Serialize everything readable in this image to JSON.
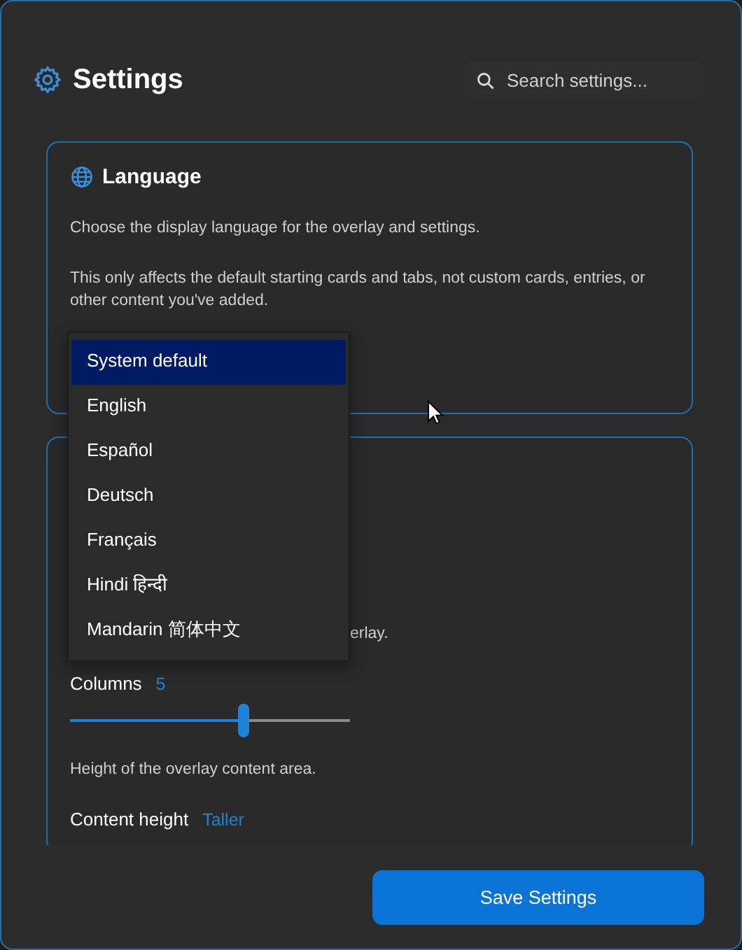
{
  "header": {
    "title": "Settings",
    "search": {
      "placeholder": "Search settings..."
    }
  },
  "language_card": {
    "title": "Language",
    "description": "Choose the display language for the overlay and settings.",
    "note": "This only affects the default starting cards and tabs, not custom cards, entries, or other content you've added."
  },
  "language_dropdown": {
    "options": [
      {
        "label": "System default",
        "selected": true
      },
      {
        "label": "English",
        "selected": false
      },
      {
        "label": "Español",
        "selected": false
      },
      {
        "label": "Deutsch",
        "selected": false
      },
      {
        "label": "Français",
        "selected": false
      },
      {
        "label": "Hindi हिन्दी",
        "selected": false
      },
      {
        "label": "Mandarin 简体中文",
        "selected": false
      }
    ]
  },
  "layout_card": {
    "description_fragment": "erlay.",
    "columns": {
      "label": "Columns",
      "value": "5",
      "level": 0.62
    },
    "height_description": "Height of the overlay content area.",
    "content_height": {
      "label": "Content height",
      "value": "Taller"
    }
  },
  "footer": {
    "save_button": "Save Settings"
  }
}
